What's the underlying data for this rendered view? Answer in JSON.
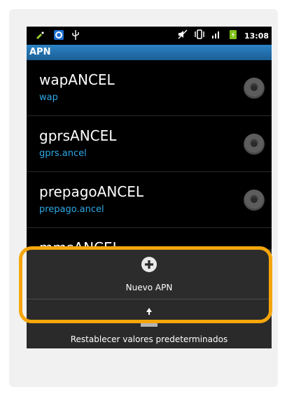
{
  "status_bar": {
    "time": "13:08",
    "left_icons": [
      "usb-edit-icon",
      "sync-icon",
      "usb-icon"
    ],
    "right_icons": [
      "mute-icon",
      "vibrate-icon",
      "signal-icon",
      "battery-charging-icon"
    ]
  },
  "title": "APN",
  "apns": [
    {
      "name": "wapANCEL",
      "apn": "wap"
    },
    {
      "name": "gprsANCEL",
      "apn": "gprs.ancel"
    },
    {
      "name": "prepagoANCEL",
      "apn": "prepago.ancel"
    },
    {
      "name": "mmsANCEL",
      "apn": ""
    }
  ],
  "menu": {
    "new_apn": "Nuevo APN",
    "reset": "Restablecer valores predeterminados"
  },
  "colors": {
    "accent": "#2ea8e6",
    "highlight": "#f5a60c",
    "title_bar": "#2c83c4"
  }
}
